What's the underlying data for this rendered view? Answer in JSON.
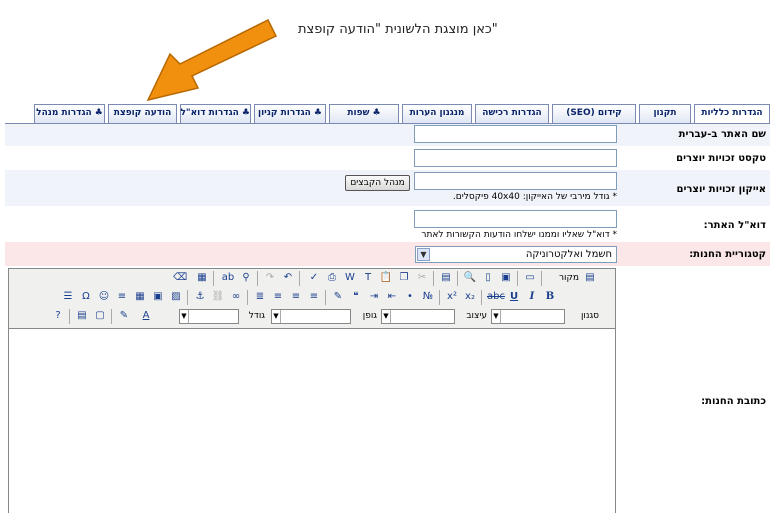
{
  "annotation": "כאן מוצגת הלשונית \"הודעה קופצת\"",
  "tabs": [
    {
      "label": "הגדרות כלליות",
      "active": true
    },
    {
      "label": "תקנון"
    },
    {
      "label": "קידום (SEO)"
    },
    {
      "label": "הגדרות רכישה"
    },
    {
      "label": "מנגנון הערות"
    },
    {
      "label": "♣ שפות"
    },
    {
      "label": "♣ הגדרות קניון"
    },
    {
      "label": "♣ הגדרות דוא\"ל"
    },
    {
      "label": "הודעה קופצת"
    },
    {
      "label": "♣ הגדרות מנהל"
    }
  ],
  "form": {
    "site_name_hebrew": {
      "label": "שם האתר ב-עברית",
      "value": ""
    },
    "copyright_text": {
      "label": "טקסט זכויות יוצרים",
      "value": ""
    },
    "copyright_icon": {
      "label": "אייקון זכויות יוצרים",
      "value": "",
      "button": "מנהל הקבצים",
      "hint": "* גודל מירבי של האייקון: 40x40 פיקסלים."
    },
    "site_email": {
      "label": "דוא\"ל האתר:",
      "value": "",
      "hint": "* דוא\"ל שאליו וממנו ישלחו הודעות הקשורות לאתר"
    },
    "store_category": {
      "label": "קטגוריית החנות:",
      "selected": "חשמל ואלקטרוניקה"
    },
    "store_address": {
      "label": "כתובת החנות:"
    }
  },
  "editor": {
    "source_label": "מקור",
    "style_label": "סגנון",
    "format_label": "עיצוב",
    "font_label": "גופן",
    "size_label": "גודל",
    "content": ""
  }
}
